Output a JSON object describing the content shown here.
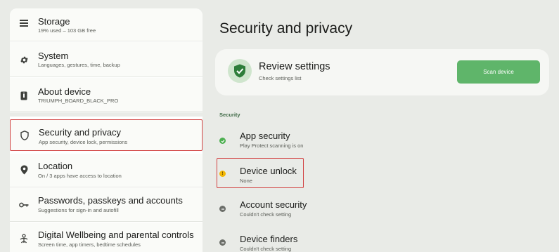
{
  "sidebar": {
    "items": [
      {
        "icon": "storage-icon",
        "label": "Storage",
        "sublabel": "19% used – 103 GB free"
      },
      {
        "icon": "gear-icon",
        "label": "System",
        "sublabel": "Languages, gestures, time, backup"
      },
      {
        "icon": "device-info-icon",
        "label": "About device",
        "sublabel": "TRIUMPH_BOARD_BLACK_PRO"
      },
      {
        "icon": "shield-icon",
        "label": "Security and privacy",
        "sublabel": "App security, device lock, permissions"
      },
      {
        "icon": "location-pin-icon",
        "label": "Location",
        "sublabel": "On / 3 apps have access to location"
      },
      {
        "icon": "key-icon",
        "label": "Passwords, passkeys and accounts",
        "sublabel": "Suggestions for sign-in and autofill"
      },
      {
        "icon": "wellbeing-icon",
        "label": "Digital Wellbeing and parental controls",
        "sublabel": "Screen time, app timers, bedtime schedules"
      }
    ]
  },
  "main": {
    "title": "Security and privacy",
    "review": {
      "title": "Review settings",
      "subtitle": "Check settings list",
      "button": "Scan device"
    },
    "section_label": "Security",
    "items": [
      {
        "label": "App security",
        "sublabel": "Play Protect scanning is on",
        "status": "ok"
      },
      {
        "label": "Device unlock",
        "sublabel": "None",
        "status": "warning"
      },
      {
        "label": "Account security",
        "sublabel": "Couldn't check setting",
        "status": "unknown"
      },
      {
        "label": "Device finders",
        "sublabel": "Couldn't check setting",
        "status": "unknown"
      }
    ]
  },
  "colors": {
    "accent_green": "#5fb56a",
    "ok_green": "#4caf50",
    "warning_yellow": "#f2b705",
    "unknown_gray": "#6b6e69",
    "selection_red": "#d24343"
  }
}
